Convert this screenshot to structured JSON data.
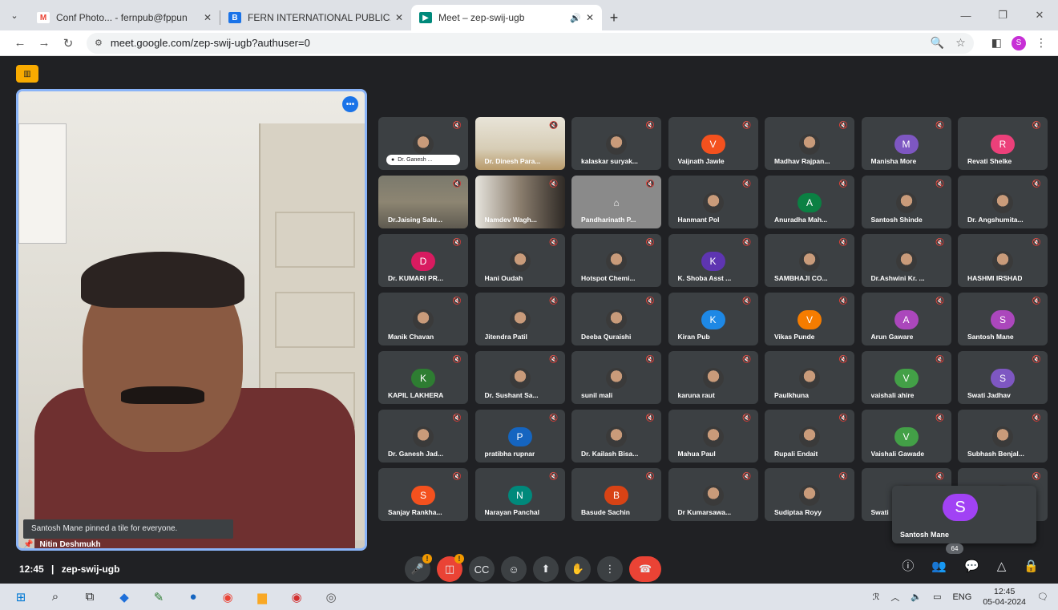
{
  "browser": {
    "tabs": [
      {
        "title": "Conf Photo... - fernpub@fppun",
        "favicon": "gmail-icon"
      },
      {
        "title": "FERN INTERNATIONAL PUBLICA",
        "favicon": "site-icon"
      },
      {
        "title": "Meet – zep-swij-ugb",
        "favicon": "meet-icon"
      }
    ],
    "url": "meet.google.com/zep-swij-ugb?authuser=0",
    "profile_initial": "S"
  },
  "meet": {
    "main_participant": "Nitin Deshmukh",
    "pin_notice": "Santosh Mane pinned a tile for everyone.",
    "time": "12:45",
    "separator": "|",
    "code": "zep-swij-ugb",
    "participant_count": "64",
    "floating_self": {
      "name": "Santosh Mane",
      "initial": "S",
      "color": "#a142f4"
    },
    "participants": [
      {
        "name": "Dr. Ganesh ...",
        "type": "chip"
      },
      {
        "name": "Dr. Dinesh Para...",
        "type": "video2"
      },
      {
        "name": "kalaskar suryak...",
        "type": "photo"
      },
      {
        "name": "Vaijnath Jawle",
        "type": "initial",
        "initial": "V",
        "color": "#f4511e"
      },
      {
        "name": "Madhav Rajpan...",
        "type": "photo"
      },
      {
        "name": "Manisha More",
        "type": "initial",
        "initial": "M",
        "color": "#7e57c2"
      },
      {
        "name": "Revati Shelke",
        "type": "initial",
        "initial": "R",
        "color": "#ec407a"
      },
      {
        "name": "Dr.Jaising Salu...",
        "type": "video1"
      },
      {
        "name": "Namdev Wagh...",
        "type": "video3"
      },
      {
        "name": "Pandharinath P...",
        "type": "grey"
      },
      {
        "name": "Hanmant Pol",
        "type": "photo"
      },
      {
        "name": "Anuradha Mah...",
        "type": "initial",
        "initial": "A",
        "color": "#0b8043"
      },
      {
        "name": "Santosh Shinde",
        "type": "photo"
      },
      {
        "name": "Dr. Angshumita...",
        "type": "photo"
      },
      {
        "name": "Dr. KUMARI PR...",
        "type": "initial",
        "initial": "D",
        "color": "#d81b60"
      },
      {
        "name": "Hani Oudah",
        "type": "photo"
      },
      {
        "name": "Hotspot Chemi...",
        "type": "photo"
      },
      {
        "name": "K. Shoba Asst ...",
        "type": "initial",
        "initial": "K",
        "color": "#5e35b1"
      },
      {
        "name": "SAMBHAJI CO...",
        "type": "photo"
      },
      {
        "name": "Dr.Ashwini Kr. ...",
        "type": "photo"
      },
      {
        "name": "HASHMI IRSHAD",
        "type": "photo"
      },
      {
        "name": "Manik Chavan",
        "type": "photo"
      },
      {
        "name": "Jitendra Patil",
        "type": "photo"
      },
      {
        "name": "Deeba Quraishi",
        "type": "photo"
      },
      {
        "name": "Kiran Pub",
        "type": "initial",
        "initial": "K",
        "color": "#1e88e5"
      },
      {
        "name": "Vikas Punde",
        "type": "initial",
        "initial": "V",
        "color": "#f57c00"
      },
      {
        "name": "Arun Gaware",
        "type": "initial",
        "initial": "A",
        "color": "#ab47bc"
      },
      {
        "name": "Santosh Mane",
        "type": "initial",
        "initial": "S",
        "color": "#ab47bc"
      },
      {
        "name": "KAPIL LAKHERA",
        "type": "initial",
        "initial": "K",
        "color": "#2e7d32"
      },
      {
        "name": "Dr. Sushant Sa...",
        "type": "photo"
      },
      {
        "name": "sunil mali",
        "type": "photo"
      },
      {
        "name": "karuna raut",
        "type": "photo"
      },
      {
        "name": "Paulkhuna",
        "type": "photo"
      },
      {
        "name": "vaishali ahire",
        "type": "initial",
        "initial": "V",
        "color": "#43a047"
      },
      {
        "name": "Swati Jadhav",
        "type": "initial",
        "initial": "S",
        "color": "#7e57c2"
      },
      {
        "name": "Dr. Ganesh Jad...",
        "type": "photo"
      },
      {
        "name": "pratibha rupnar",
        "type": "initial",
        "initial": "P",
        "color": "#1565c0"
      },
      {
        "name": "Dr. Kailash Bisa...",
        "type": "photo"
      },
      {
        "name": "Mahua Paul",
        "type": "photo"
      },
      {
        "name": "Rupali Endait",
        "type": "photo"
      },
      {
        "name": "Vaishali Gawade",
        "type": "initial",
        "initial": "V",
        "color": "#43a047"
      },
      {
        "name": "Subhash Benjal...",
        "type": "photo"
      },
      {
        "name": "Sanjay Rankha...",
        "type": "initial",
        "initial": "S",
        "color": "#f4511e"
      },
      {
        "name": "Narayan Panchal",
        "type": "initial",
        "initial": "N",
        "color": "#00897b"
      },
      {
        "name": "Basude Sachin",
        "type": "initial",
        "initial": "B",
        "color": "#d84315"
      },
      {
        "name": "Dr Kumarsawa...",
        "type": "photo"
      },
      {
        "name": "Sudiptaa Royy",
        "type": "photo"
      },
      {
        "name": "Swati",
        "type": "photo"
      },
      {
        "name": "",
        "type": "photo"
      }
    ]
  },
  "taskbar": {
    "language": "ENG",
    "time": "12:45",
    "date": "05-04-2024"
  }
}
